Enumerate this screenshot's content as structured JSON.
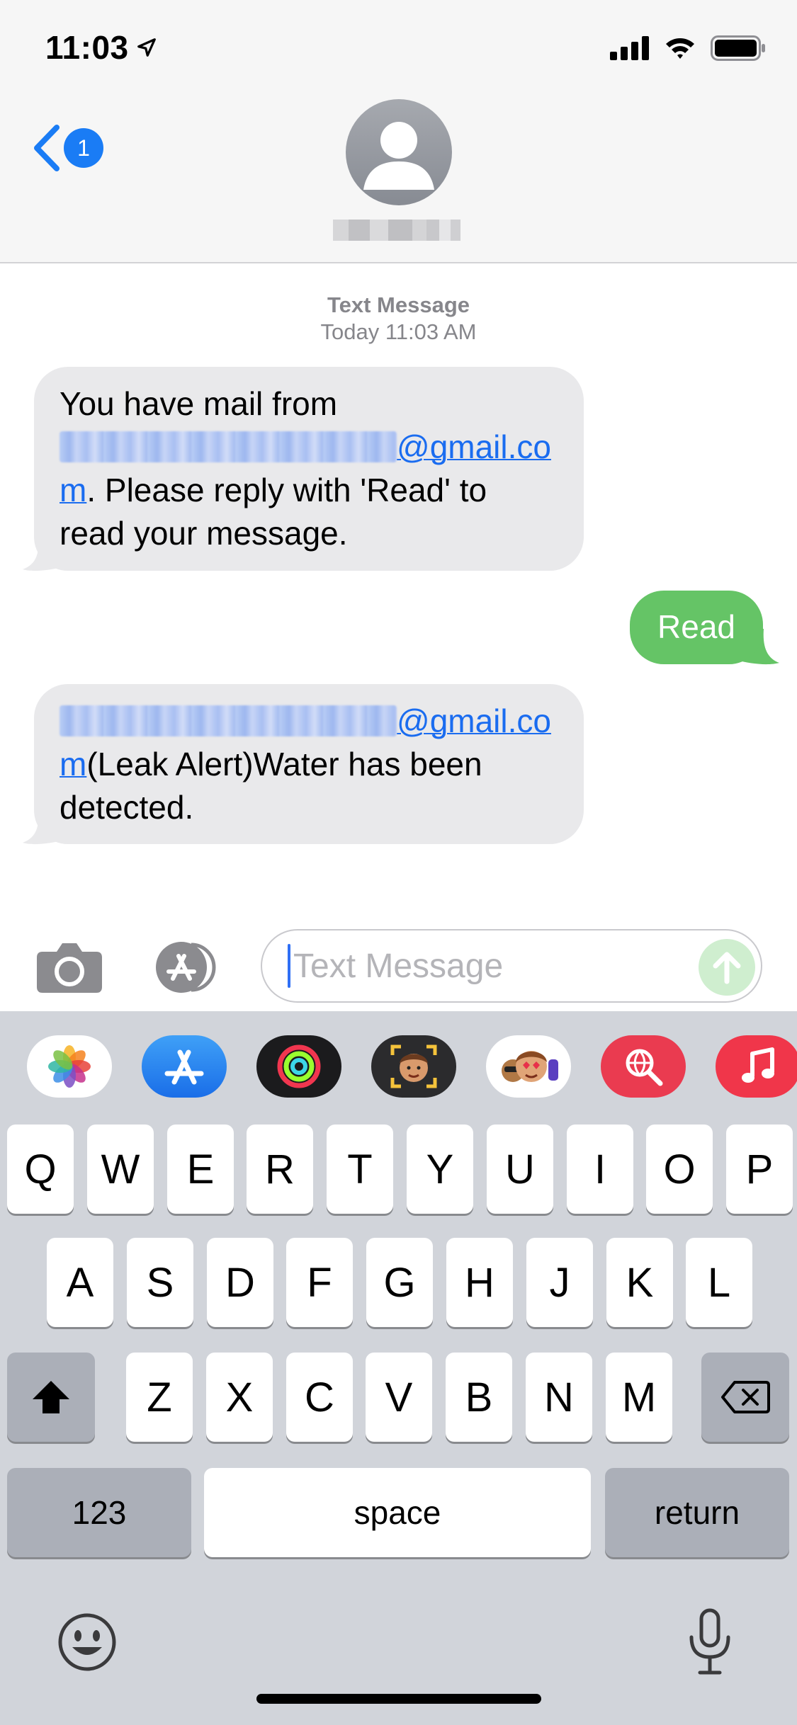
{
  "status_bar": {
    "time": "11:03",
    "location_icon": "location-arrow-icon",
    "signal_icon": "cellular-signal-icon",
    "wifi_icon": "wifi-icon",
    "battery_icon": "battery-icon"
  },
  "header": {
    "back_icon": "chevron-left-icon",
    "unread_badge": "1",
    "avatar_icon": "person-avatar-icon"
  },
  "conversation": {
    "service_label": "Text Message",
    "timestamp": "Today 11:03 AM",
    "messages": [
      {
        "direction": "incoming",
        "line1": "You have mail from",
        "link_tail": "@gmail.co",
        "link_wrap": "m",
        "rest_line2": ". Please reply with 'Read' to",
        "line3": "read your message."
      },
      {
        "direction": "outgoing",
        "text": "Read"
      },
      {
        "direction": "incoming",
        "link_tail": "@gmail.co",
        "link_wrap": "m",
        "rest_line2": "(Leak Alert)Water has been",
        "line3": "detected."
      }
    ]
  },
  "compose": {
    "camera_icon": "camera-icon",
    "apps_icon": "app-store-icon",
    "placeholder": "Text Message",
    "send_icon": "arrow-up-icon"
  },
  "app_drawer": [
    "photos-icon",
    "app-store-icon",
    "activity-icon",
    "memoji-sticker-icon",
    "animoji-icon",
    "web-search-icon",
    "music-icon"
  ],
  "keyboard": {
    "row1": [
      "Q",
      "W",
      "E",
      "R",
      "T",
      "Y",
      "U",
      "I",
      "O",
      "P"
    ],
    "row2": [
      "A",
      "S",
      "D",
      "F",
      "G",
      "H",
      "J",
      "K",
      "L"
    ],
    "row3": [
      "Z",
      "X",
      "C",
      "V",
      "B",
      "N",
      "M"
    ],
    "shift_icon": "shift-icon",
    "delete_icon": "delete-icon",
    "numbers_label": "123",
    "space_label": "space",
    "return_label": "return",
    "emoji_icon": "emoji-icon",
    "dictation_icon": "microphone-icon"
  }
}
